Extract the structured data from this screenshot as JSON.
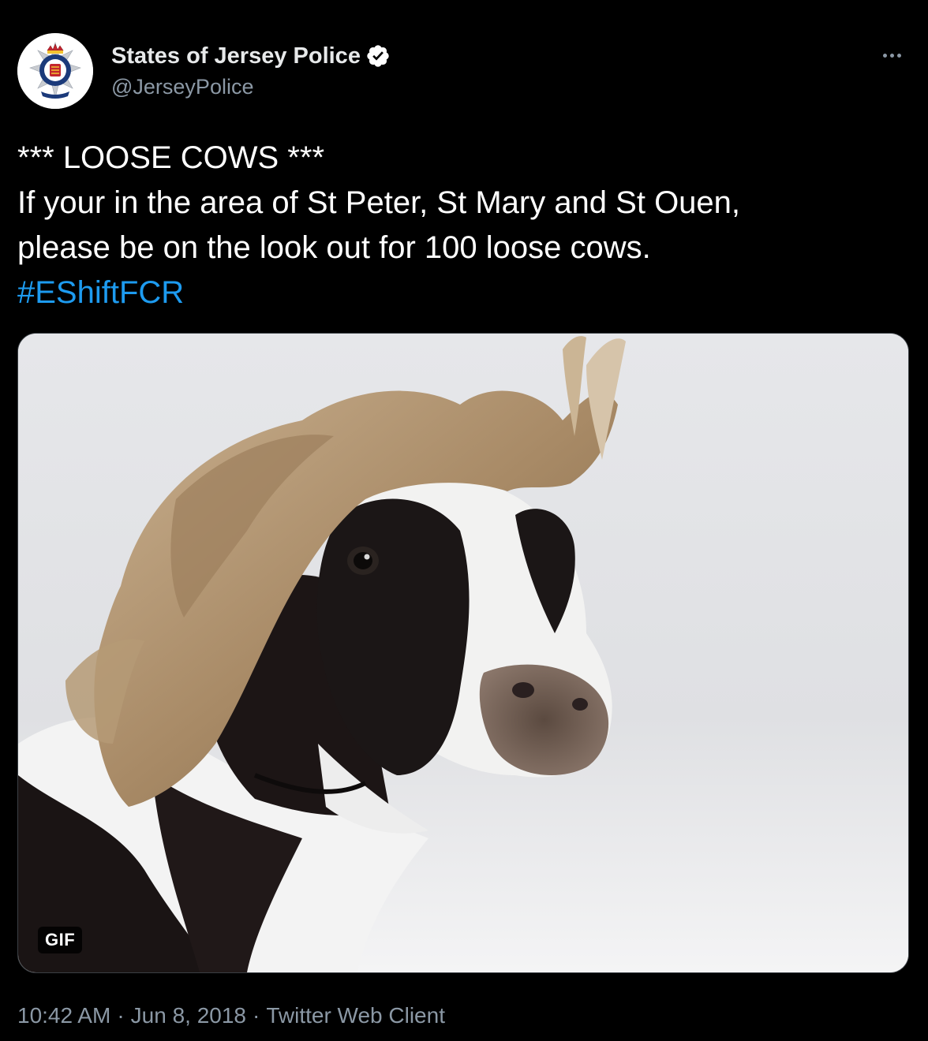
{
  "author": {
    "display_name": "States of Jersey Police",
    "handle": "@JerseyPolice",
    "verified": true,
    "avatar_icon": "police-crest-icon",
    "avatar_crest_text": "STATES OF JERSEY POLICE"
  },
  "tweet": {
    "lines": [
      "*** LOOSE COWS ***",
      "If your in the area of St Peter, St Mary and St Ouen,",
      "please be on the look out for 100 loose cows."
    ],
    "hashtag": "#EShiftFCR"
  },
  "media": {
    "type": "gif",
    "badge": "GIF",
    "subject": "cow-with-flowing-hair"
  },
  "meta": {
    "time": "10:42 AM",
    "separator": "·",
    "date": "Jun 8, 2018",
    "source": "Twitter Web Client"
  },
  "actions": {
    "more_icon": "more-horizontal-icon"
  },
  "colors": {
    "background": "#000000",
    "text": "#ffffff",
    "secondary": "#8b98a5",
    "link": "#1d9bf0",
    "verified_badge": "#ffffff"
  }
}
